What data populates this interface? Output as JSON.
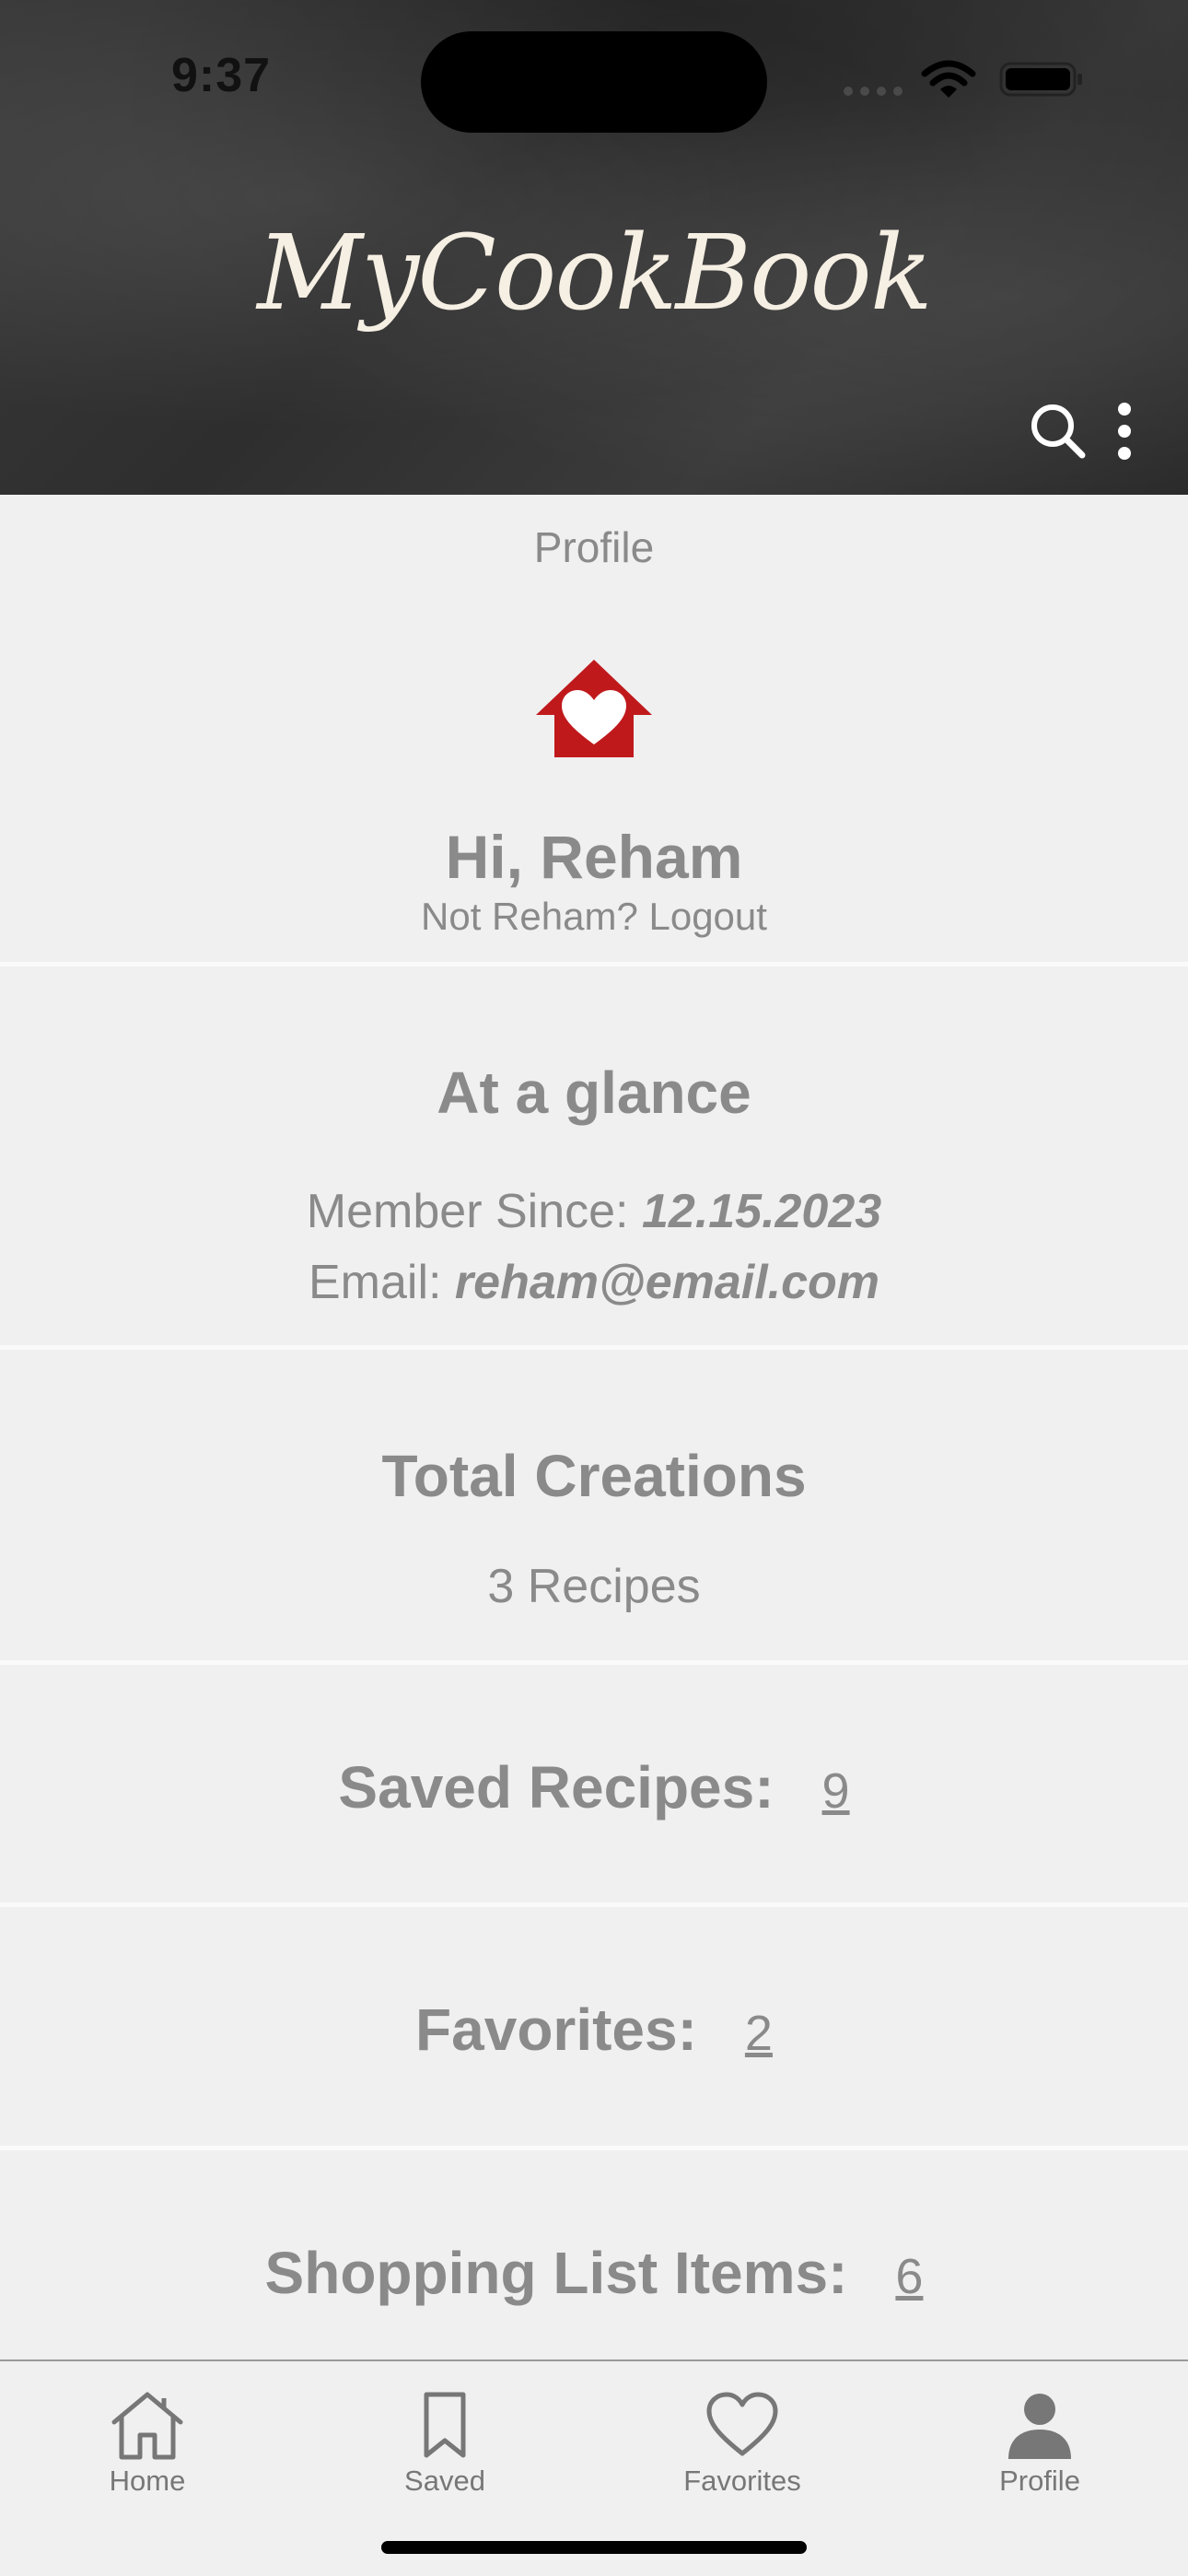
{
  "status_bar": {
    "time": "9:37"
  },
  "header": {
    "app_title": "MyCookBook",
    "icons": [
      "search-icon",
      "more-vertical-icon"
    ]
  },
  "profile": {
    "page_label": "Profile",
    "logo_icon": "house-heart-icon",
    "greeting": "Hi, Reham",
    "not_user_text": "Not Reham?",
    "logout_label": "Logout"
  },
  "glance": {
    "heading": "At a glance",
    "member_since_label": "Member Since:",
    "member_since_value": "12.15.2023",
    "email_label": "Email:",
    "email_value": "reham@email.com"
  },
  "creations": {
    "heading": "Total Creations",
    "value": "3 Recipes"
  },
  "stats": {
    "saved_label": "Saved Recipes:",
    "saved_count": "9",
    "favorites_label": "Favorites:",
    "favorites_count": "2",
    "shopping_label": "Shopping List Items:",
    "shopping_count": "6"
  },
  "tabs": [
    {
      "label": "Home",
      "icon": "home-icon"
    },
    {
      "label": "Saved",
      "icon": "bookmark-icon"
    },
    {
      "label": "Favorites",
      "icon": "heart-icon"
    },
    {
      "label": "Profile",
      "icon": "person-icon",
      "active": true
    }
  ],
  "colors": {
    "accent_red": "#c0191c",
    "text_gray": "#8a8a8a",
    "background": "#f0f0f0",
    "title_cream": "#f6efe3"
  }
}
